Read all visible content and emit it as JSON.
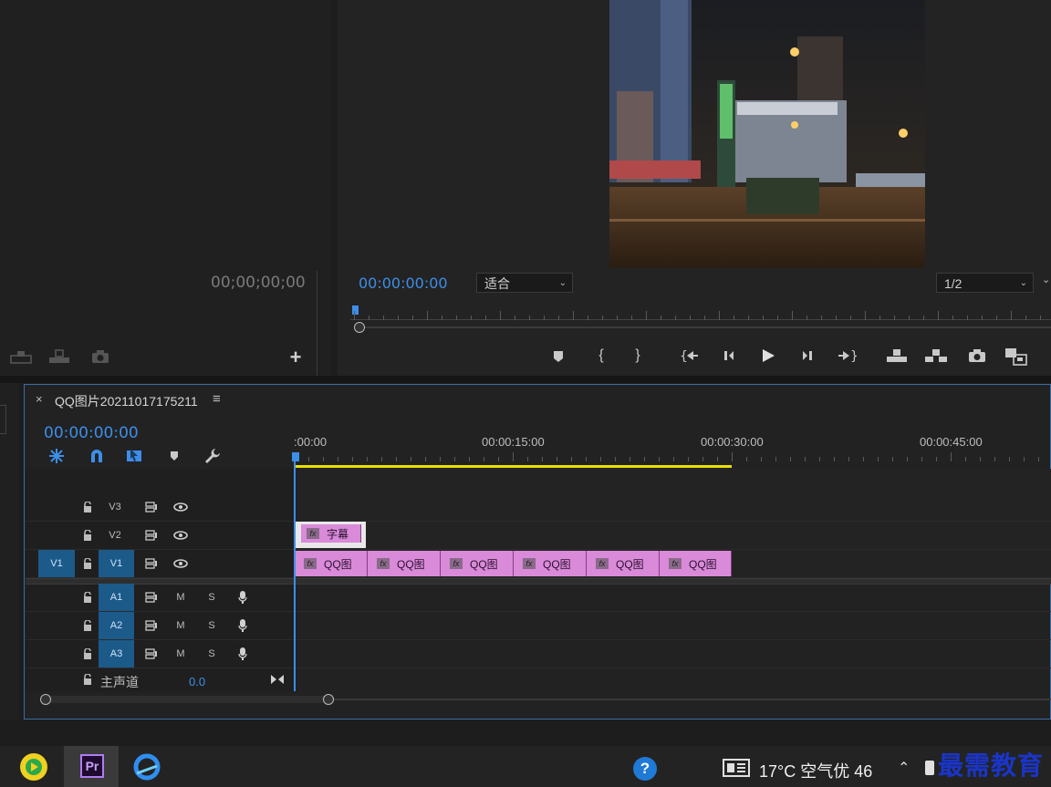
{
  "source_monitor": {
    "timecode": "00;00;00;00",
    "icons": [
      "insert-icon",
      "overwrite-icon",
      "export-frame-icon",
      "add-button-icon"
    ]
  },
  "program_monitor": {
    "timecode": "00:00:00:00",
    "zoom_select": "适合",
    "resolution_select": "1/2",
    "controls": [
      "marker-icon",
      "mark-in-icon",
      "mark-out-icon",
      "go-to-in-icon",
      "step-back-icon",
      "play-icon",
      "step-forward-icon",
      "go-to-out-icon",
      "lift-icon",
      "extract-icon",
      "export-frame-icon",
      "comparison-view-icon"
    ]
  },
  "timeline": {
    "sequence_title": "QQ图片20211017175211",
    "close_glyph": "×",
    "menu_glyph": "≡",
    "timecode": "00:00:00:00",
    "ruler_labels": [
      ":00:00",
      "00:00:15:00",
      "00:00:30:00",
      "00:00:45:00"
    ],
    "tracks": {
      "video": [
        {
          "name": "V3",
          "source": ""
        },
        {
          "name": "V2",
          "source": ""
        },
        {
          "name": "V1",
          "source": "V1"
        }
      ],
      "audio": [
        {
          "name": "A1",
          "m": "M",
          "s": "S"
        },
        {
          "name": "A2",
          "m": "M",
          "s": "S"
        },
        {
          "name": "A3",
          "m": "M",
          "s": "S"
        }
      ],
      "master": {
        "label": "主声道",
        "value": "0.0"
      }
    },
    "clips_v2": [
      {
        "label": "字幕",
        "fx": "fx"
      }
    ],
    "clips_v1": [
      {
        "label": "QQ图",
        "fx": "fx"
      },
      {
        "label": "QQ图",
        "fx": "fx"
      },
      {
        "label": "QQ图",
        "fx": "fx"
      },
      {
        "label": "QQ图",
        "fx": "fx"
      },
      {
        "label": "QQ图",
        "fx": "fx"
      },
      {
        "label": "QQ图",
        "fx": "fx"
      }
    ]
  },
  "taskbar": {
    "weather": "17°C 空气优 46",
    "watermark": "最需教育",
    "apps": [
      "media-player-icon",
      "premiere-icon",
      "qq-browser-icon"
    ],
    "premiere_label": "Pr"
  },
  "colors": {
    "accent_blue": "#3d8ee8",
    "clip_pink": "#d98ad8",
    "track_blue": "#1c5a8a",
    "work_area_yellow": "#e8e000"
  }
}
